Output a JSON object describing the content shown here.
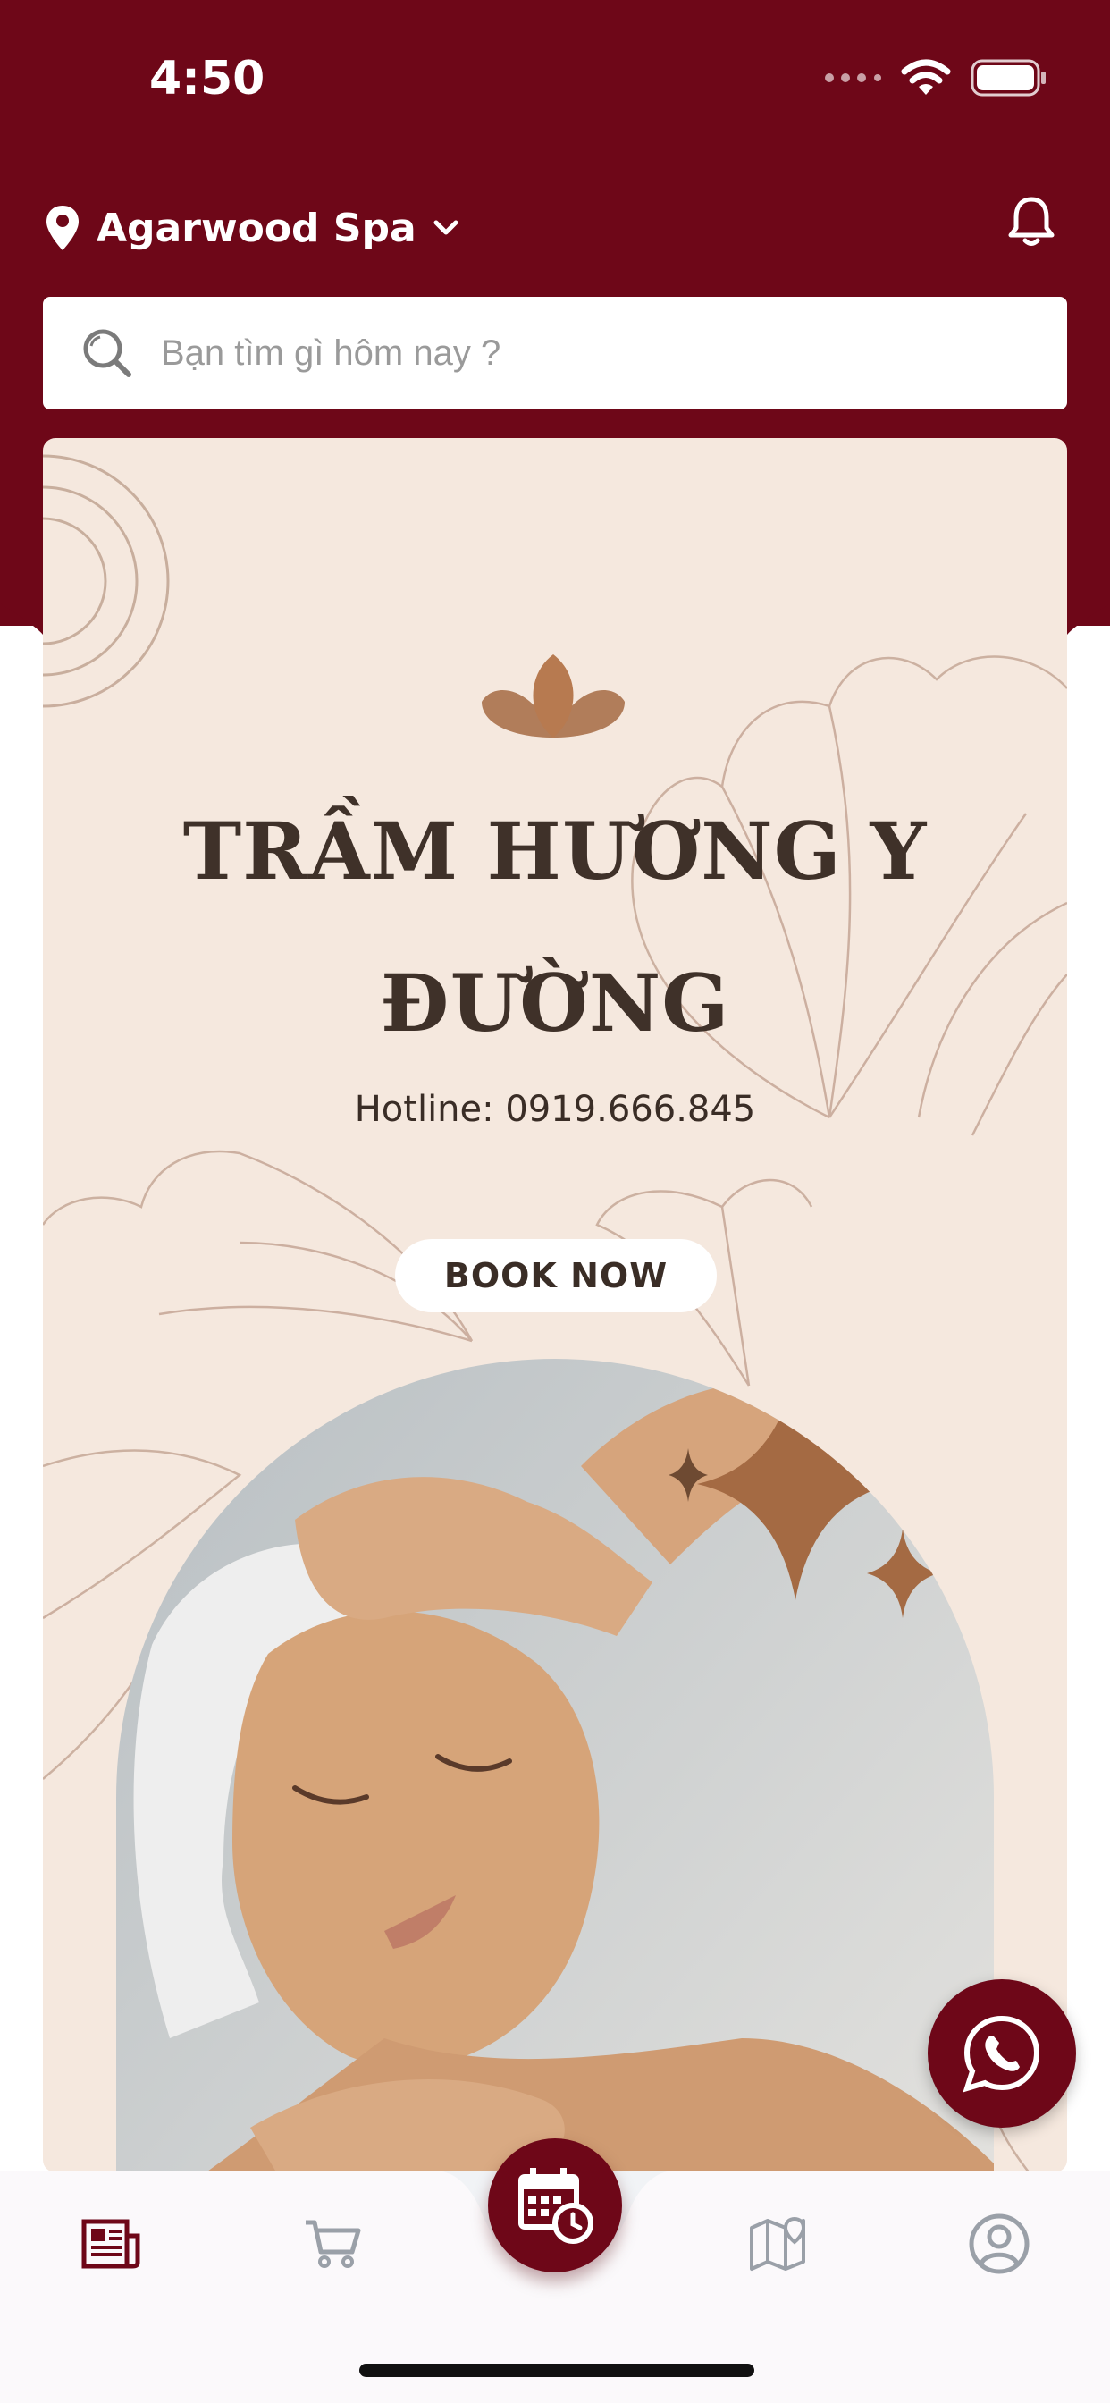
{
  "status_bar": {
    "time": "4:50"
  },
  "header": {
    "location_name": "Agarwood Spa"
  },
  "search": {
    "placeholder": "Bạn tìm gì hôm nay ?"
  },
  "banner": {
    "title_line1": "TRẦM HƯƠNG Y",
    "title_line2": "ĐƯỜNG",
    "hotline": "Hotline: 0919.666.845",
    "book_label": "BOOK NOW"
  },
  "tabbar": {
    "items": [
      "news-icon",
      "cart-icon",
      "booking-calendar-icon",
      "map-icon",
      "profile-icon"
    ],
    "active_color": "#6e0718",
    "inactive_color": "#9aa0a8"
  },
  "colors": {
    "brand": "#6e0718",
    "banner_bg": "#f5e8de",
    "accent_brown": "#a46a43"
  }
}
